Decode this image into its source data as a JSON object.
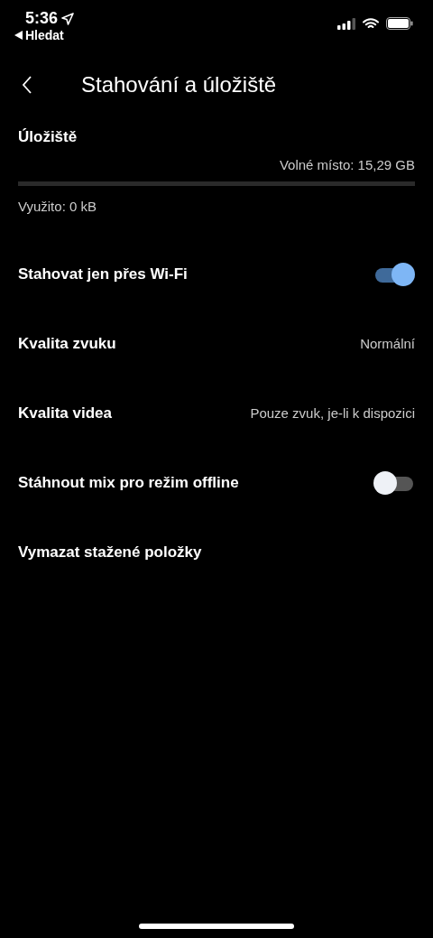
{
  "status_bar": {
    "time": "5:36",
    "back_label": "Hledat"
  },
  "header": {
    "title": "Stahování a úložiště"
  },
  "storage": {
    "title": "Úložiště",
    "free": "Volné místo: 15,29 GB",
    "level": 0,
    "used": "Využito: 0 kB"
  },
  "settings": [
    {
      "kind": "toggle",
      "label": "Stahovat jen přes Wi-Fi",
      "on": true
    },
    {
      "kind": "value",
      "label": "Kvalita zvuku",
      "value": "Normální"
    },
    {
      "kind": "value",
      "label": "Kvalita videa",
      "value": "Pouze zvuk, je-li k dispozici"
    },
    {
      "kind": "toggle",
      "label": "Stáhnout mix pro režim offline",
      "on": false
    },
    {
      "kind": "action",
      "label": "Vymazat stažené položky"
    }
  ]
}
